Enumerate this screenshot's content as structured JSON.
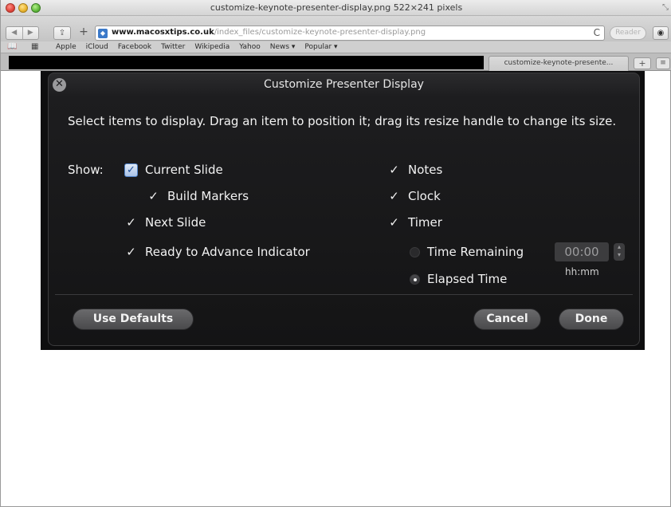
{
  "window": {
    "title": "customize-keynote-presenter-display.png 522×241 pixels",
    "resize_glyph": "⤡"
  },
  "toolbar": {
    "back_glyph": "◀",
    "forward_glyph": "▶",
    "share_glyph": "⇪",
    "plus_glyph": "+",
    "url_domain": "www.macosxtips.co.uk",
    "url_path": "/index_files/customize-keynote-presenter-display.png",
    "reload_glyph": "C",
    "reader_label": "Reader",
    "downloads_glyph": "◉"
  },
  "bookmarks": {
    "book_glyph": "📖",
    "grid_glyph": "▦",
    "items": [
      "Apple",
      "iCloud",
      "Facebook",
      "Twitter",
      "Wikipedia",
      "Yahoo",
      "News ▾",
      "Popular ▾"
    ]
  },
  "tabs": {
    "active_label": "customize-keynote-presente...",
    "new_tab_glyph": "+",
    "tab_list_glyph": "≡"
  },
  "dialog": {
    "title": "Customize Presenter Display",
    "close_glyph": "✕",
    "instructions": "Select items to display. Drag an item to position it; drag its resize handle to change its size.",
    "show_label": "Show:",
    "check_glyph": "✓",
    "options": {
      "current_slide": "Current Slide",
      "build_markers": "Build Markers",
      "next_slide": "Next Slide",
      "ready_indicator": "Ready to Advance Indicator",
      "notes": "Notes",
      "clock": "Clock",
      "timer": "Timer",
      "time_remaining": "Time Remaining",
      "elapsed_time": "Elapsed Time"
    },
    "time_value": "00:00",
    "stepper_glyph_up": "▴",
    "stepper_glyph_down": "▾",
    "time_format": "hh:mm",
    "buttons": {
      "defaults": "Use Defaults",
      "cancel": "Cancel",
      "done": "Done"
    },
    "selected_timer_mode": "Elapsed Time"
  }
}
